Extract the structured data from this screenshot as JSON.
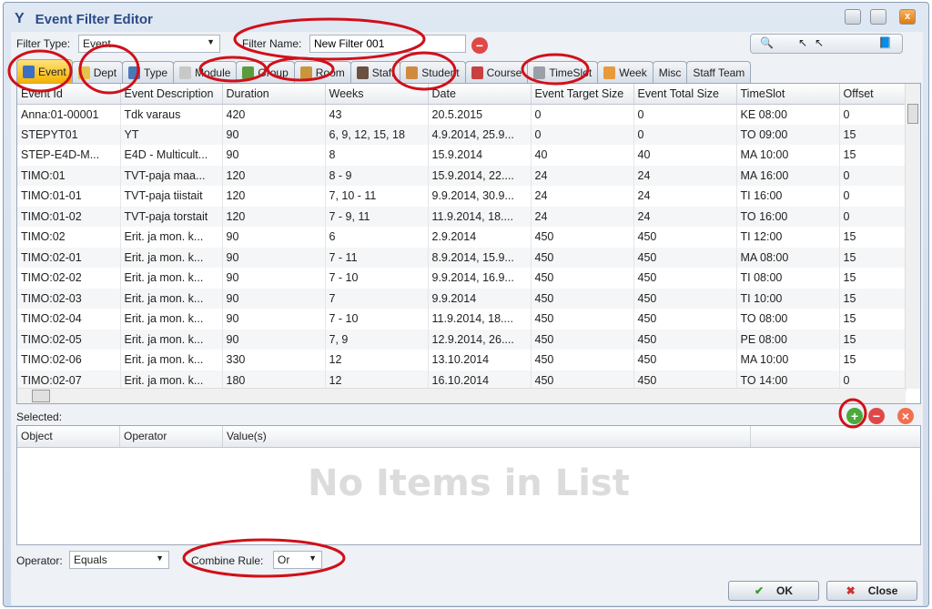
{
  "window": {
    "title": "Event Filter Editor"
  },
  "filter": {
    "type_label": "Filter Type:",
    "type_value": "Event",
    "name_label": "Filter Name:",
    "name_value": "New Filter 001"
  },
  "tabs": [
    {
      "label": "Event",
      "icon": "event-icon",
      "color": "#3b6fc4"
    },
    {
      "label": "Dept",
      "icon": "dept-icon",
      "color": "#e7c34a"
    },
    {
      "label": "Type",
      "icon": "type-icon",
      "color": "#4a78b8"
    },
    {
      "label": "Module",
      "icon": "module-icon",
      "color": "#c8c8c8"
    },
    {
      "label": "Group",
      "icon": "group-icon",
      "color": "#5a9c3c"
    },
    {
      "label": "Room",
      "icon": "room-icon",
      "color": "#c9963c"
    },
    {
      "label": "Staff",
      "icon": "staff-icon",
      "color": "#6a5040"
    },
    {
      "label": "Student",
      "icon": "student-icon",
      "color": "#d08a40"
    },
    {
      "label": "Course",
      "icon": "course-icon",
      "color": "#c84040"
    },
    {
      "label": "TimeSlot",
      "icon": "timeslot-icon",
      "color": "#9aa0a8"
    },
    {
      "label": "Week",
      "icon": "week-icon",
      "color": "#e89a3a"
    },
    {
      "label": "Misc",
      "icon": "",
      "color": ""
    },
    {
      "label": "Staff Team",
      "icon": "",
      "color": ""
    }
  ],
  "active_tab": "Event",
  "table": {
    "columns": [
      "Event Id",
      "Event Description",
      "Duration",
      "Weeks",
      "Date",
      "Event Target Size",
      "Event Total Size",
      "TimeSlot",
      "Offset"
    ],
    "rows": [
      [
        "Anna:01-00001",
        "Tdk varaus",
        "420",
        "43",
        "20.5.2015",
        "0",
        "0",
        "KE 08:00",
        "0"
      ],
      [
        "STEPYT01",
        "YT",
        "90",
        "6, 9, 12, 15, 18",
        "4.9.2014, 25.9...",
        "0",
        "0",
        "TO 09:00",
        "15"
      ],
      [
        "STEP-E4D-M...",
        "E4D - Multicult...",
        "90",
        "8",
        "15.9.2014",
        "40",
        "40",
        "MA 10:00",
        "15"
      ],
      [
        "TIMO:01",
        "TVT-paja maa...",
        "120",
        "8 - 9",
        "15.9.2014, 22....",
        "24",
        "24",
        "MA 16:00",
        "0"
      ],
      [
        "TIMO:01-01",
        "TVT-paja tiistait",
        "120",
        "7, 10 - 11",
        "9.9.2014, 30.9...",
        "24",
        "24",
        "TI 16:00",
        "0"
      ],
      [
        "TIMO:01-02",
        "TVT-paja torstait",
        "120",
        "7 - 9, 11",
        "11.9.2014, 18....",
        "24",
        "24",
        "TO 16:00",
        "0"
      ],
      [
        "TIMO:02",
        "Erit. ja mon. k...",
        "90",
        "6",
        "2.9.2014",
        "450",
        "450",
        "TI 12:00",
        "15"
      ],
      [
        "TIMO:02-01",
        "Erit. ja mon. k...",
        "90",
        "7 - 11",
        "8.9.2014, 15.9...",
        "450",
        "450",
        "MA 08:00",
        "15"
      ],
      [
        "TIMO:02-02",
        "Erit. ja mon. k...",
        "90",
        "7 - 10",
        "9.9.2014, 16.9...",
        "450",
        "450",
        "TI 08:00",
        "15"
      ],
      [
        "TIMO:02-03",
        "Erit. ja mon. k...",
        "90",
        "7",
        "9.9.2014",
        "450",
        "450",
        "TI 10:00",
        "15"
      ],
      [
        "TIMO:02-04",
        "Erit. ja mon. k...",
        "90",
        "7 - 10",
        "11.9.2014, 18....",
        "450",
        "450",
        "TO 08:00",
        "15"
      ],
      [
        "TIMO:02-05",
        "Erit. ja mon. k...",
        "90",
        "7, 9",
        "12.9.2014, 26....",
        "450",
        "450",
        "PE 08:00",
        "15"
      ],
      [
        "TIMO:02-06",
        "Erit. ja mon. k...",
        "330",
        "12",
        "13.10.2014",
        "450",
        "450",
        "MA 10:00",
        "15"
      ],
      [
        "TIMO:02-07",
        "Erit. ja mon. k...",
        "180",
        "12",
        "16.10.2014",
        "450",
        "450",
        "TO 14:00",
        "0"
      ]
    ]
  },
  "selected": {
    "label": "Selected:",
    "columns": [
      "Object",
      "Operator",
      "Value(s)"
    ],
    "empty_text": "No Items in List"
  },
  "bottom": {
    "operator_label": "Operator:",
    "operator_value": "Equals",
    "combine_label": "Combine Rule:",
    "combine_value": "Or"
  },
  "buttons": {
    "ok": "OK",
    "close": "Close"
  },
  "colors": {
    "annotation": "#d0101a",
    "accent": "#2b4a86"
  }
}
